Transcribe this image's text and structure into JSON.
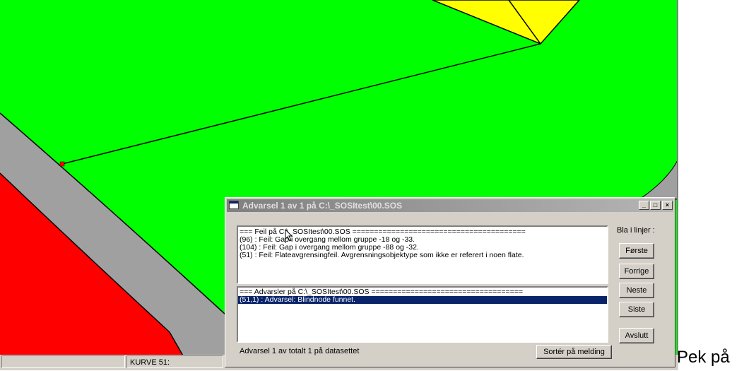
{
  "map": {
    "colors": {
      "area_green": "#00ff00",
      "area_red": "#ff0000",
      "road_gray": "#a0a0a0",
      "area_yellow": "#ffff00",
      "line": "#000000",
      "node_marker": "#ff0000"
    }
  },
  "statusbar": {
    "field2": "KURVE 51:"
  },
  "side_text": "Pek på",
  "dialog": {
    "title": "Advarsel 1 av 1 på C:\\_SOSItest\\00.SOS",
    "titlebar_buttons": [
      "_",
      "□",
      "×"
    ],
    "errors": [
      "=== Feil på C:\\_SOSItest\\00.SOS ========================================",
      "(96) : Feil: Gap i overgang mellom gruppe -18 og -33.",
      "(104) : Feil: Gap i overgang mellom gruppe -88 og -32.",
      "(51) : Feil: Flateavgrensingfeil. Avgrensningsobjektype som ikke er referert i noen flate."
    ],
    "warnings": [
      "=== Advarsler på C:\\_SOSItest\\00.SOS ===================================",
      "(51,1) : Advarsel: Blindnode funnet."
    ],
    "selected_warning": 1,
    "browse_label": "Bla i linjer :",
    "buttons": {
      "first": "Første",
      "prev": "Forrige",
      "next": "Neste",
      "last": "Siste",
      "exit": "Avslutt"
    },
    "status": "Advarsel 1 av totalt 1 på datasettet",
    "sort_button": "Sortér på melding",
    "accent": "#0a246a"
  }
}
